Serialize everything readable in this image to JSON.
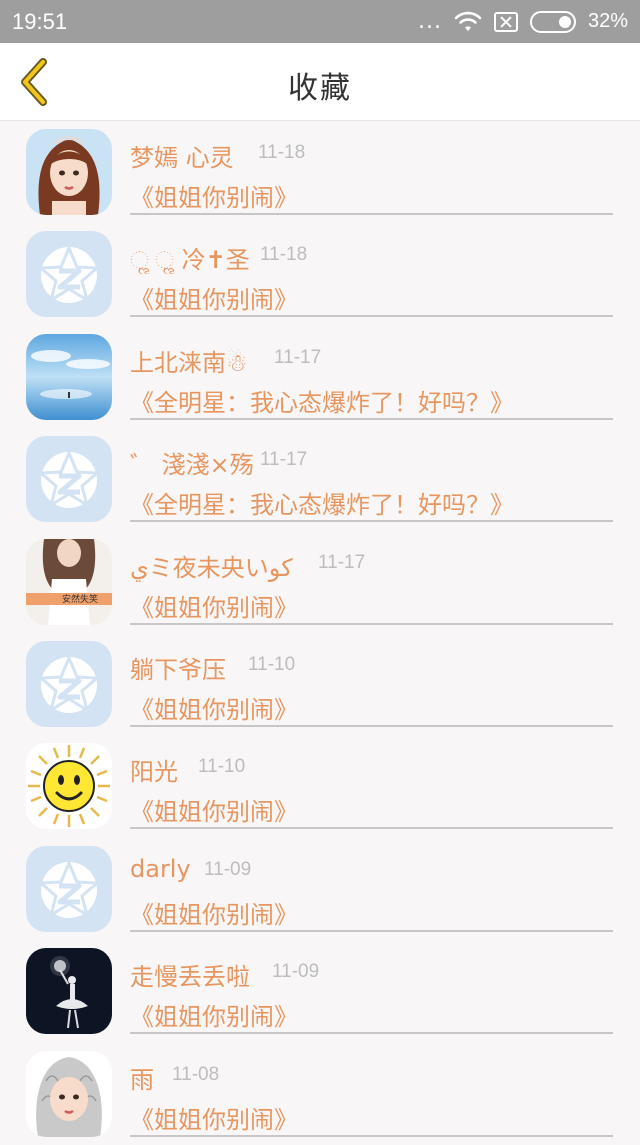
{
  "status": {
    "time": "19:51",
    "dots": "...",
    "battery_text": "32%",
    "battery_level": 0.32
  },
  "header": {
    "title": "收藏",
    "back_icon": "chevron-left-icon",
    "back_color": "#e6b800"
  },
  "colors": {
    "accent": "#e8965f",
    "date": "#bdbdbd",
    "default_avatar": "#d4e3f4"
  },
  "items": [
    {
      "name": "梦嫣 心灵",
      "date": "11-18",
      "title": "《姐姐你别闹》",
      "avatar": "girl-portrait-avatar"
    },
    {
      "name": "ૢ ૢ 冷✝圣",
      "date": "11-18",
      "title": "《姐姐你别闹》",
      "avatar": "default-star-avatar"
    },
    {
      "name": "上北涞南☃",
      "date": "11-17",
      "title": "《全明星：我心态爆炸了！好吗？》",
      "avatar": "sky-sea-avatar"
    },
    {
      "name": "゛ 淺淺×殇",
      "date": "11-17",
      "title": "《全明星：我心态爆炸了！好吗？》",
      "avatar": "default-star-avatar"
    },
    {
      "name": "يミ夜未央いکو",
      "date": "11-17",
      "title": "《姐姐你别闹》",
      "avatar": "photo-woman-avatar",
      "avatar_caption": "安然失笑"
    },
    {
      "name": "躺下爷压",
      "date": "11-10",
      "title": "《姐姐你别闹》",
      "avatar": "default-star-avatar"
    },
    {
      "name": "阳光",
      "date": "11-10",
      "title": "《姐姐你别闹》",
      "avatar": "sun-smiley-avatar"
    },
    {
      "name": "darly",
      "date": "11-09",
      "title": "《姐姐你别闹》",
      "avatar": "default-star-avatar"
    },
    {
      "name": "走慢丢丢啦",
      "date": "11-09",
      "title": "《姐姐你别闹》",
      "avatar": "dancer-night-avatar"
    },
    {
      "name": "雨",
      "date": "11-08",
      "title": "《姐姐你别闹》",
      "avatar": "silver-hair-girl-avatar"
    }
  ]
}
